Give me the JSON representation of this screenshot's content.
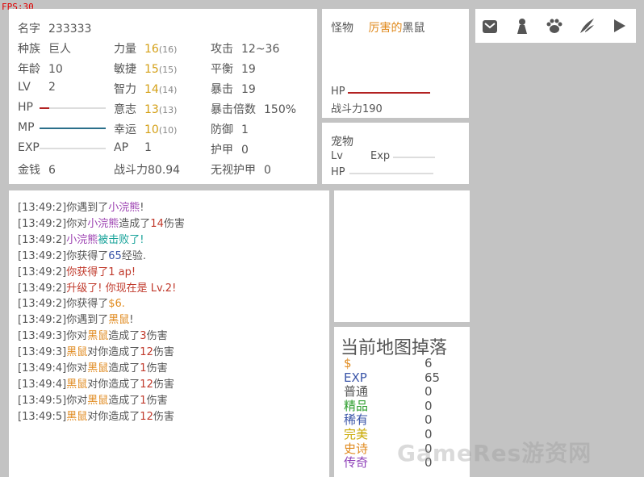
{
  "fps": "FPS:30",
  "stats": {
    "name_label": "名字",
    "name": "233333",
    "race_label": "种族",
    "race": "巨人",
    "age_label": "年龄",
    "age": "10",
    "lv_label": "LV",
    "lv": "2",
    "hp_label": "HP",
    "hp_fraction": 0.15,
    "mp_label": "MP",
    "mp_fraction": 1.0,
    "exp_label": "EXP",
    "exp_fraction": 0.0,
    "gold_label": "金钱",
    "gold": "6",
    "str_label": "力量",
    "str": "16",
    "str_base": "(16)",
    "agi_label": "敏捷",
    "agi": "15",
    "agi_base": "(15)",
    "int_label": "智力",
    "int": "14",
    "int_base": "(14)",
    "will_label": "意志",
    "will": "13",
    "will_base": "(13)",
    "luck_label": "幸运",
    "luck": "10",
    "luck_base": "(10)",
    "ap_label": "AP",
    "ap": "1",
    "power_label": "战斗力",
    "power": "80.94",
    "atk_label": "攻击",
    "atk": "12~36",
    "bal_label": "平衡",
    "bal": "19",
    "crit_label": "暴击",
    "crit": "19",
    "critmul_label": "暴击倍数",
    "critmul": "150%",
    "def_label": "防御",
    "def": "1",
    "armor_label": "护甲",
    "armor": "0",
    "pierce_label": "无视护甲",
    "pierce": "0"
  },
  "monster": {
    "label": "怪物",
    "prefix": "厉害的",
    "name": "黑鼠",
    "hp_label": "HP",
    "hp_fraction": 1.0,
    "power_label": "战斗力",
    "power": "190"
  },
  "pet": {
    "label": "宠物",
    "lv_label": "Lv",
    "exp_label": "Exp",
    "hp_label": "HP"
  },
  "log": [
    [
      {
        "t": "[13:49:2]你遇到了"
      },
      {
        "t": "小浣熊",
        "c": "purple"
      },
      {
        "t": "!"
      }
    ],
    [
      {
        "t": "[13:49:2]你对"
      },
      {
        "t": "小浣熊",
        "c": "purple"
      },
      {
        "t": "造成了"
      },
      {
        "t": "14",
        "c": "red"
      },
      {
        "t": "伤害"
      }
    ],
    [
      {
        "t": "[13:49:2]"
      },
      {
        "t": "小浣熊",
        "c": "purple"
      },
      {
        "t": "被击败了!",
        "c": "teal"
      }
    ],
    [
      {
        "t": "[13:49:2]你获得了"
      },
      {
        "t": "65",
        "c": "blue"
      },
      {
        "t": "经验."
      }
    ],
    [
      {
        "t": "[13:49:2]"
      },
      {
        "t": "你获得了",
        "c": "red"
      },
      {
        "t": "1 ap!",
        "c": "red"
      }
    ],
    [
      {
        "t": "[13:49:2]"
      },
      {
        "t": "升级了! 你现在是 Lv.2!",
        "c": "red"
      }
    ],
    [
      {
        "t": "[13:49:2]你获得了"
      },
      {
        "t": "$6.",
        "c": "orange"
      }
    ],
    [
      {
        "t": "[13:49:2]你遇到了"
      },
      {
        "t": "黑鼠",
        "c": "orange"
      },
      {
        "t": "!"
      }
    ],
    [
      {
        "t": "[13:49:3]你对"
      },
      {
        "t": "黑鼠",
        "c": "orange"
      },
      {
        "t": "造成了"
      },
      {
        "t": "3",
        "c": "red"
      },
      {
        "t": "伤害"
      }
    ],
    [
      {
        "t": "[13:49:3]"
      },
      {
        "t": "黑鼠",
        "c": "orange"
      },
      {
        "t": "对你造成了"
      },
      {
        "t": "12",
        "c": "red"
      },
      {
        "t": "伤害"
      }
    ],
    [
      {
        "t": "[13:49:4]你对"
      },
      {
        "t": "黑鼠",
        "c": "orange"
      },
      {
        "t": "造成了"
      },
      {
        "t": "1",
        "c": "red"
      },
      {
        "t": "伤害"
      }
    ],
    [
      {
        "t": "[13:49:4]"
      },
      {
        "t": "黑鼠",
        "c": "orange"
      },
      {
        "t": "对你造成了"
      },
      {
        "t": "12",
        "c": "red"
      },
      {
        "t": "伤害"
      }
    ],
    [
      {
        "t": "[13:49:5]你对"
      },
      {
        "t": "黑鼠",
        "c": "orange"
      },
      {
        "t": "造成了"
      },
      {
        "t": "1",
        "c": "red"
      },
      {
        "t": "伤害"
      }
    ],
    [
      {
        "t": "[13:49:5]"
      },
      {
        "t": "黑鼠",
        "c": "orange"
      },
      {
        "t": "对你造成了"
      },
      {
        "t": "12",
        "c": "red"
      },
      {
        "t": "伤害"
      }
    ]
  ],
  "drops": {
    "title": "当前地图掉落",
    "rows": [
      {
        "label": "$",
        "value": "6",
        "color": "#e08a1e"
      },
      {
        "label": "EXP",
        "value": "65",
        "color": "#3a55a8"
      },
      {
        "label": "普通",
        "value": "0",
        "color": "#555555"
      },
      {
        "label": "精品",
        "value": "0",
        "color": "#2e9e2e"
      },
      {
        "label": "稀有",
        "value": "0",
        "color": "#3a55a8"
      },
      {
        "label": "完美",
        "value": "0",
        "color": "#c8a800"
      },
      {
        "label": "史诗",
        "value": "0",
        "color": "#e08a1e"
      },
      {
        "label": "传奇",
        "value": "0",
        "color": "#8e3fb8"
      }
    ]
  },
  "toolbar": {
    "icons": [
      "bag-icon",
      "character-icon",
      "paw-icon",
      "skill-icon",
      "play-icon"
    ]
  },
  "colors": {
    "hp": "#b22222",
    "mp": "#2a6f8a",
    "monster_hp": "#b22222"
  },
  "watermark": "GameRes游资网"
}
